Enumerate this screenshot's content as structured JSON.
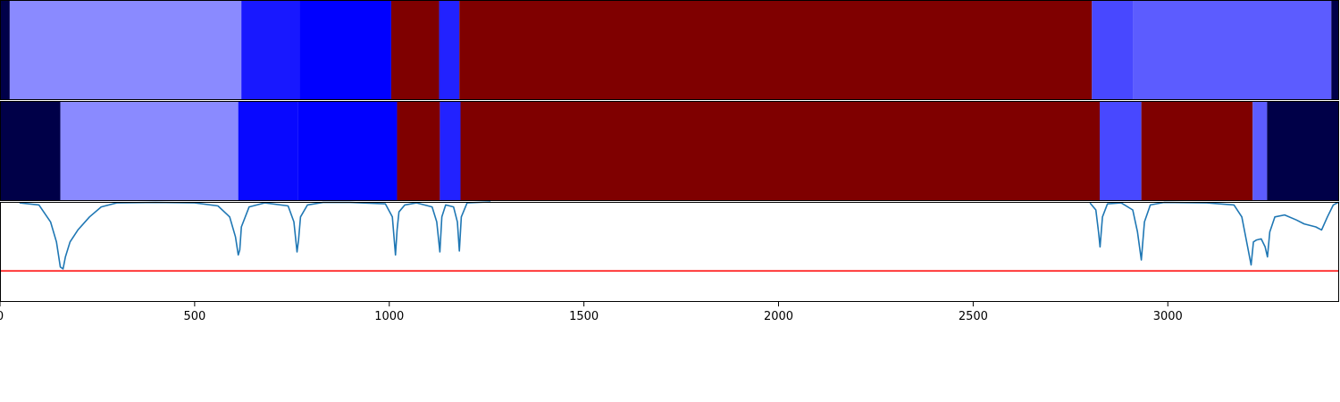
{
  "chart_data": [
    {
      "type": "heatmap",
      "description_key": "band_top",
      "x_range": [
        0,
        3440
      ],
      "segments": [
        {
          "start": 0,
          "end": 25,
          "color": "#000048"
        },
        {
          "start": 25,
          "end": 620,
          "color": "#8a8aff"
        },
        {
          "start": 620,
          "end": 770,
          "color": "#1818ff"
        },
        {
          "start": 770,
          "end": 1005,
          "color": "#0000ff"
        },
        {
          "start": 1005,
          "end": 1128,
          "color": "#7f0000"
        },
        {
          "start": 1128,
          "end": 1180,
          "color": "#2222ff"
        },
        {
          "start": 1180,
          "end": 2805,
          "color": "#7f0000"
        },
        {
          "start": 2805,
          "end": 2910,
          "color": "#4848ff"
        },
        {
          "start": 2910,
          "end": 3420,
          "color": "#5c5cff"
        },
        {
          "start": 3420,
          "end": 3440,
          "color": "#000048"
        }
      ]
    },
    {
      "type": "heatmap",
      "description_key": "band_middle",
      "x_range": [
        0,
        3440
      ],
      "segments": [
        {
          "start": 0,
          "end": 155,
          "color": "#000048"
        },
        {
          "start": 155,
          "end": 612,
          "color": "#8a8aff"
        },
        {
          "start": 612,
          "end": 765,
          "color": "#0808ff"
        },
        {
          "start": 765,
          "end": 1020,
          "color": "#0000ff"
        },
        {
          "start": 1020,
          "end": 1130,
          "color": "#7f0000"
        },
        {
          "start": 1130,
          "end": 1183,
          "color": "#2222ff"
        },
        {
          "start": 1183,
          "end": 2825,
          "color": "#7f0000"
        },
        {
          "start": 2825,
          "end": 2932,
          "color": "#4848ff"
        },
        {
          "start": 2932,
          "end": 3218,
          "color": "#7f0000"
        },
        {
          "start": 3218,
          "end": 3255,
          "color": "#5c5cff"
        },
        {
          "start": 3255,
          "end": 3440,
          "color": "#000048"
        }
      ]
    },
    {
      "type": "line",
      "x_range": [
        0,
        3440
      ],
      "ylim": [
        0.0,
        1.0
      ],
      "xticks": [
        0,
        500,
        1000,
        1500,
        2000,
        2500,
        3000
      ],
      "xtick_labels": [
        "0",
        "500",
        "1000",
        "1500",
        "2000",
        "2500",
        "3000"
      ],
      "line_color": "#1f77b4",
      "threshold": {
        "y": 0.31,
        "color": "#ff0000"
      },
      "series": [
        {
          "x": [
            50,
            100,
            130,
            145,
            155,
            162,
            168,
            180,
            200,
            230,
            260,
            300,
            400,
            500,
            560,
            590,
            605,
            612,
            616,
            620,
            640,
            680,
            740,
            755,
            763,
            767,
            772,
            790,
            830,
            900,
            990,
            1008,
            1016,
            1020,
            1025,
            1040,
            1070,
            1110,
            1122,
            1130,
            1135,
            1145,
            1165,
            1175,
            1180,
            1185,
            1200,
            1260
          ],
          "y": [
            0.99,
            0.97,
            0.8,
            0.6,
            0.35,
            0.33,
            0.45,
            0.6,
            0.72,
            0.85,
            0.95,
            0.99,
            0.995,
            0.99,
            0.96,
            0.85,
            0.65,
            0.47,
            0.52,
            0.75,
            0.95,
            0.99,
            0.96,
            0.8,
            0.5,
            0.62,
            0.85,
            0.97,
            0.995,
            0.995,
            0.98,
            0.85,
            0.47,
            0.72,
            0.9,
            0.97,
            0.99,
            0.95,
            0.8,
            0.5,
            0.85,
            0.97,
            0.95,
            0.8,
            0.51,
            0.85,
            0.99,
            1.0
          ]
        },
        {
          "x": [
            2800,
            2815,
            2822,
            2826,
            2832,
            2845,
            2880,
            2910,
            2922,
            2932,
            2940,
            2955,
            2990,
            3100,
            3170,
            3190,
            3205,
            3214,
            3220,
            3228,
            3240,
            3250,
            3256,
            3262,
            3275,
            3300,
            3330,
            3350,
            3380,
            3395,
            3410,
            3425,
            3440
          ],
          "y": [
            0.99,
            0.92,
            0.7,
            0.55,
            0.85,
            0.98,
            0.99,
            0.92,
            0.7,
            0.42,
            0.8,
            0.97,
            0.995,
            0.99,
            0.97,
            0.85,
            0.55,
            0.37,
            0.6,
            0.62,
            0.63,
            0.55,
            0.45,
            0.7,
            0.85,
            0.87,
            0.82,
            0.78,
            0.75,
            0.72,
            0.85,
            0.97,
            1.0
          ]
        }
      ]
    }
  ]
}
